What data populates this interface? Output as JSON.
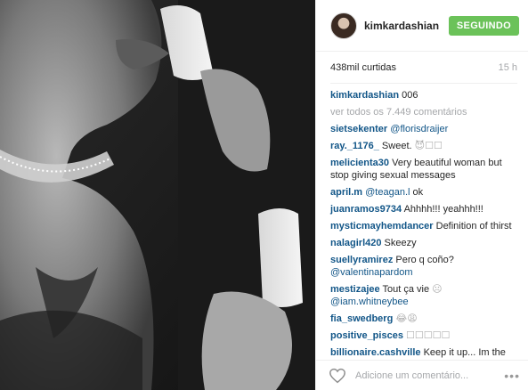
{
  "post": {
    "username": "kimkardashian",
    "follow_label": "SEGUINDO",
    "likes": "438mil curtidas",
    "time": "15 h"
  },
  "comments": [
    {
      "user": "kimkardashian",
      "text": "006"
    },
    {
      "user": "",
      "text": "ver todos os 7.449 comentários",
      "type": "view-all"
    },
    {
      "user": "sietsekenter",
      "mention": "@florisdraijer",
      "text": ""
    },
    {
      "user": "ray._1176_",
      "text": "Sweet.",
      "emoji": "😈☐☐"
    },
    {
      "user": "melicienta30",
      "text": "Very beautiful woman but stop giving sexual messages"
    },
    {
      "user": "april.m",
      "mention": "@teagan.l",
      "text": "ok"
    },
    {
      "user": "juanramos9734",
      "text": "Ahhhh!!! yeahhh!!!"
    },
    {
      "user": "mysticmayhemdancer",
      "text": "Definition of thirst"
    },
    {
      "user": "nalagirl420",
      "text": "Skeezy"
    },
    {
      "user": "suellyramirez",
      "text": "Pero q coño?",
      "mention2": "@valentinapardom"
    },
    {
      "user": "mestizajee",
      "text": "Tout ça vie",
      "emoji": "☹",
      "mention2": "@iam.whitneybee"
    },
    {
      "user": "fia_swedberg",
      "text": "",
      "emoji": "😂😩"
    },
    {
      "user": "positive_pisces",
      "text": "",
      "emoji": "☐☐☐☐☐"
    },
    {
      "user": "billionaire.cashville",
      "text": "Keep it up... Im the"
    }
  ],
  "footer": {
    "placeholder": "Adicione um comentário...",
    "more": "•••",
    "icons": [
      "heart-icon",
      "more-options-icon"
    ]
  },
  "colors": {
    "follow_green": "#6bc259",
    "link_blue": "#125688",
    "muted": "#a5a7aa"
  }
}
